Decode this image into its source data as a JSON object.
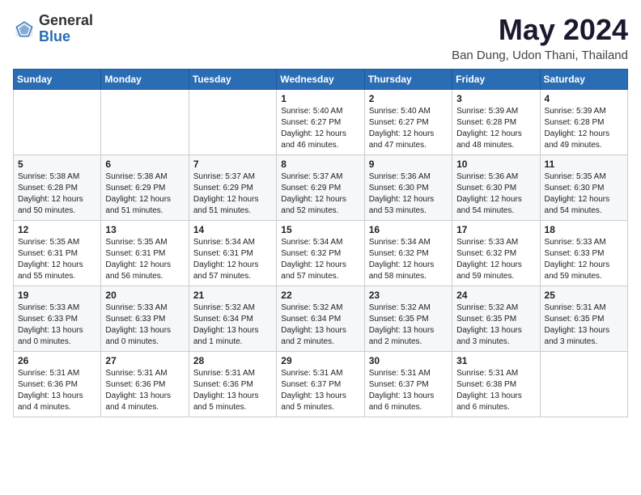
{
  "logo": {
    "general": "General",
    "blue": "Blue"
  },
  "title": "May 2024",
  "location": "Ban Dung, Udon Thani, Thailand",
  "days_of_week": [
    "Sunday",
    "Monday",
    "Tuesday",
    "Wednesday",
    "Thursday",
    "Friday",
    "Saturday"
  ],
  "weeks": [
    [
      {
        "day": "",
        "content": ""
      },
      {
        "day": "",
        "content": ""
      },
      {
        "day": "",
        "content": ""
      },
      {
        "day": "1",
        "content": "Sunrise: 5:40 AM\nSunset: 6:27 PM\nDaylight: 12 hours\nand 46 minutes."
      },
      {
        "day": "2",
        "content": "Sunrise: 5:40 AM\nSunset: 6:27 PM\nDaylight: 12 hours\nand 47 minutes."
      },
      {
        "day": "3",
        "content": "Sunrise: 5:39 AM\nSunset: 6:28 PM\nDaylight: 12 hours\nand 48 minutes."
      },
      {
        "day": "4",
        "content": "Sunrise: 5:39 AM\nSunset: 6:28 PM\nDaylight: 12 hours\nand 49 minutes."
      }
    ],
    [
      {
        "day": "5",
        "content": "Sunrise: 5:38 AM\nSunset: 6:28 PM\nDaylight: 12 hours\nand 50 minutes."
      },
      {
        "day": "6",
        "content": "Sunrise: 5:38 AM\nSunset: 6:29 PM\nDaylight: 12 hours\nand 51 minutes."
      },
      {
        "day": "7",
        "content": "Sunrise: 5:37 AM\nSunset: 6:29 PM\nDaylight: 12 hours\nand 51 minutes."
      },
      {
        "day": "8",
        "content": "Sunrise: 5:37 AM\nSunset: 6:29 PM\nDaylight: 12 hours\nand 52 minutes."
      },
      {
        "day": "9",
        "content": "Sunrise: 5:36 AM\nSunset: 6:30 PM\nDaylight: 12 hours\nand 53 minutes."
      },
      {
        "day": "10",
        "content": "Sunrise: 5:36 AM\nSunset: 6:30 PM\nDaylight: 12 hours\nand 54 minutes."
      },
      {
        "day": "11",
        "content": "Sunrise: 5:35 AM\nSunset: 6:30 PM\nDaylight: 12 hours\nand 54 minutes."
      }
    ],
    [
      {
        "day": "12",
        "content": "Sunrise: 5:35 AM\nSunset: 6:31 PM\nDaylight: 12 hours\nand 55 minutes."
      },
      {
        "day": "13",
        "content": "Sunrise: 5:35 AM\nSunset: 6:31 PM\nDaylight: 12 hours\nand 56 minutes."
      },
      {
        "day": "14",
        "content": "Sunrise: 5:34 AM\nSunset: 6:31 PM\nDaylight: 12 hours\nand 57 minutes."
      },
      {
        "day": "15",
        "content": "Sunrise: 5:34 AM\nSunset: 6:32 PM\nDaylight: 12 hours\nand 57 minutes."
      },
      {
        "day": "16",
        "content": "Sunrise: 5:34 AM\nSunset: 6:32 PM\nDaylight: 12 hours\nand 58 minutes."
      },
      {
        "day": "17",
        "content": "Sunrise: 5:33 AM\nSunset: 6:32 PM\nDaylight: 12 hours\nand 59 minutes."
      },
      {
        "day": "18",
        "content": "Sunrise: 5:33 AM\nSunset: 6:33 PM\nDaylight: 12 hours\nand 59 minutes."
      }
    ],
    [
      {
        "day": "19",
        "content": "Sunrise: 5:33 AM\nSunset: 6:33 PM\nDaylight: 13 hours\nand 0 minutes."
      },
      {
        "day": "20",
        "content": "Sunrise: 5:33 AM\nSunset: 6:33 PM\nDaylight: 13 hours\nand 0 minutes."
      },
      {
        "day": "21",
        "content": "Sunrise: 5:32 AM\nSunset: 6:34 PM\nDaylight: 13 hours\nand 1 minute."
      },
      {
        "day": "22",
        "content": "Sunrise: 5:32 AM\nSunset: 6:34 PM\nDaylight: 13 hours\nand 2 minutes."
      },
      {
        "day": "23",
        "content": "Sunrise: 5:32 AM\nSunset: 6:35 PM\nDaylight: 13 hours\nand 2 minutes."
      },
      {
        "day": "24",
        "content": "Sunrise: 5:32 AM\nSunset: 6:35 PM\nDaylight: 13 hours\nand 3 minutes."
      },
      {
        "day": "25",
        "content": "Sunrise: 5:31 AM\nSunset: 6:35 PM\nDaylight: 13 hours\nand 3 minutes."
      }
    ],
    [
      {
        "day": "26",
        "content": "Sunrise: 5:31 AM\nSunset: 6:36 PM\nDaylight: 13 hours\nand 4 minutes."
      },
      {
        "day": "27",
        "content": "Sunrise: 5:31 AM\nSunset: 6:36 PM\nDaylight: 13 hours\nand 4 minutes."
      },
      {
        "day": "28",
        "content": "Sunrise: 5:31 AM\nSunset: 6:36 PM\nDaylight: 13 hours\nand 5 minutes."
      },
      {
        "day": "29",
        "content": "Sunrise: 5:31 AM\nSunset: 6:37 PM\nDaylight: 13 hours\nand 5 minutes."
      },
      {
        "day": "30",
        "content": "Sunrise: 5:31 AM\nSunset: 6:37 PM\nDaylight: 13 hours\nand 6 minutes."
      },
      {
        "day": "31",
        "content": "Sunrise: 5:31 AM\nSunset: 6:38 PM\nDaylight: 13 hours\nand 6 minutes."
      },
      {
        "day": "",
        "content": ""
      }
    ]
  ]
}
